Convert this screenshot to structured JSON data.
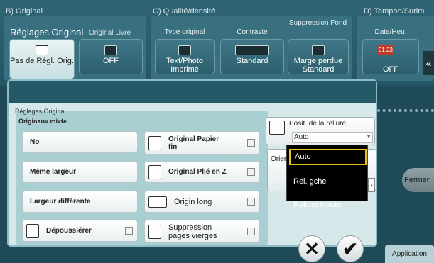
{
  "sections": {
    "original": "B) Original",
    "qualite": "C) Qualité/densité",
    "tampon": "D) Tampon/Surim"
  },
  "top": {
    "reglages_title": "Réglages Original",
    "original_livre": "Original Livre",
    "pas_de_regl": "Pas de Régl. Orig.",
    "off1": "OFF",
    "type_original": "Type original",
    "type_value": "Text/Photo Imprimé",
    "contraste": "Contraste",
    "contraste_value": "Standard",
    "suppression_fond": "Suppression Fond",
    "suppression_value": "Marge perdue Standard",
    "date_heu": "Date/Heu.",
    "date_icon_text": "01.23",
    "off2": "OFF"
  },
  "dialog": {
    "panel_title": "Réglages Original",
    "panel_sub": "Originaux mixte",
    "no": "No",
    "meme_largeur": "Même largeur",
    "largeur_differente": "Largeur différente",
    "depoussierer": "Dépoussiérer",
    "original_papier_fin": "Original Papier fin",
    "original_plie_z": "Original Plié en Z",
    "origin_long": "Origin long",
    "suppression_pages": "Suppression pages vierges",
    "posit_reliure": "Posit. de la reliure",
    "posit_value": "Auto",
    "orient_label": "Orien",
    "dropdown": [
      "Auto",
      "Rel. gche",
      "Reliure Haute"
    ]
  },
  "right": {
    "fermer": "Fermer",
    "application": "Application"
  },
  "icons": {
    "cancel": "cancel-x-icon",
    "ok": "check-ok-icon"
  }
}
